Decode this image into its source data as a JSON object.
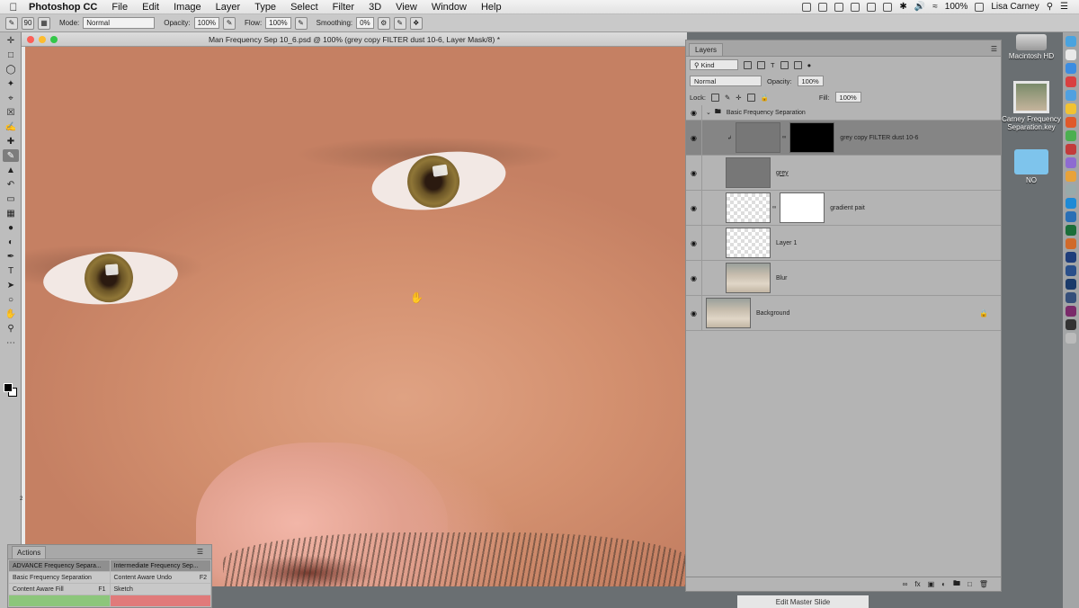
{
  "menubar": {
    "app_name": "Photoshop CC",
    "items": [
      "File",
      "Edit",
      "Image",
      "Layer",
      "Type",
      "Select",
      "Filter",
      "3D",
      "View",
      "Window",
      "Help"
    ],
    "battery": "100%",
    "user": "Lisa Carney"
  },
  "options_bar": {
    "brush_size": "90",
    "mode_label": "Mode:",
    "mode_value": "Normal",
    "opacity_label": "Opacity:",
    "opacity_value": "100%",
    "flow_label": "Flow:",
    "flow_value": "100%",
    "smoothing_label": "Smoothing:",
    "smoothing_value": "0%"
  },
  "document": {
    "title": "Man Frequency Sep 10_6.psd @ 100% (grey copy FILTER dust 10-6, Layer Mask/8) *",
    "ruler_mark": "2"
  },
  "actions_panel": {
    "tab": "Actions",
    "items": [
      {
        "label": "ADVANCE Frequency Separa...",
        "key": ""
      },
      {
        "label": "Intermediate Frequency Sep...",
        "key": ""
      },
      {
        "label": "Basic Frequency Separation",
        "key": ""
      },
      {
        "label": "Content Aware Undo",
        "key": "F2"
      },
      {
        "label": "Content Aware Fill",
        "key": "F1"
      },
      {
        "label": "Sketch",
        "key": ""
      }
    ]
  },
  "layers_panel": {
    "tab": "Layers",
    "kind_filter": "Kind",
    "blend_mode": "Normal",
    "opacity_label": "Opacity:",
    "opacity_value": "100%",
    "lock_label": "Lock:",
    "fill_label": "Fill:",
    "fill_value": "100%",
    "group_name": "Basic Frequency Separation",
    "layers": [
      {
        "name": "grey copy FILTER dust 10-6"
      },
      {
        "name": "grey"
      },
      {
        "name": "gradient pait"
      },
      {
        "name": "Layer 1"
      },
      {
        "name": "Blur"
      },
      {
        "name": "Background"
      }
    ]
  },
  "desktop": {
    "hd_label": "Macintosh HD",
    "keynote_label": "Carney Frequency Separation.key",
    "folder_label": "NO"
  },
  "edit_master": "Edit Master Slide",
  "colors": {
    "accent_selected": "#858585",
    "panel_bg": "#b4b4b4"
  }
}
